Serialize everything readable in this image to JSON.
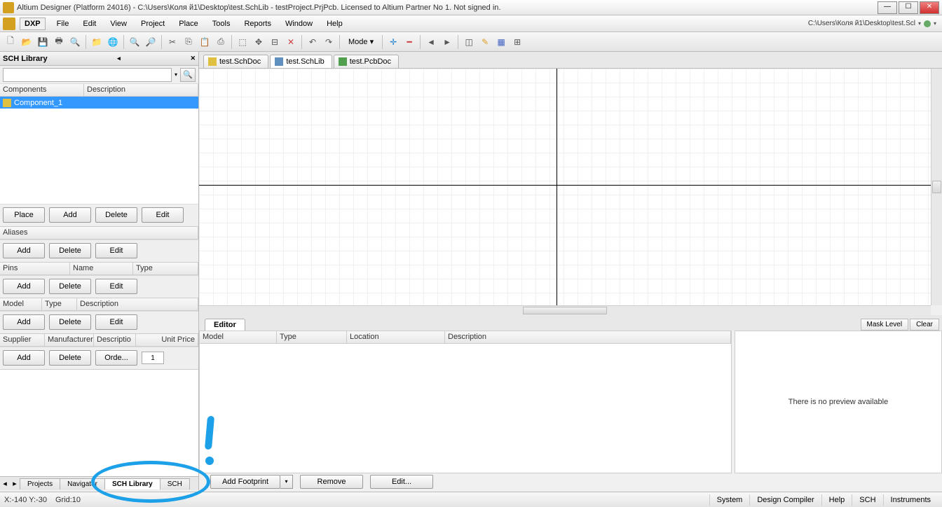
{
  "titlebar": {
    "text": "Altium Designer (Platform 24016) - C:\\Users\\Коля й1\\Desktop\\test.SchLib - testProject.PrjPcb. Licensed to Altium Partner No 1. Not signed in."
  },
  "menu": {
    "dxp": "DXP",
    "items": [
      "File",
      "Edit",
      "View",
      "Project",
      "Place",
      "Tools",
      "Reports",
      "Window",
      "Help"
    ],
    "rightpath": "C:\\Users\\Коля й1\\Desktop\\test.Scl"
  },
  "toolbar": {
    "mode": "Mode"
  },
  "doctabs": [
    {
      "label": "test.SchDoc",
      "color": "#e0c040"
    },
    {
      "label": "test.SchLib",
      "color": "#6090c0",
      "active": true
    },
    {
      "label": "test.PcbDoc",
      "color": "#50a050"
    }
  ],
  "panel": {
    "title": "SCH Library",
    "components": {
      "cols": [
        "Components",
        "Description"
      ],
      "rows": [
        {
          "name": "Component_1"
        }
      ]
    },
    "btns1": [
      "Place",
      "Add",
      "Delete",
      "Edit"
    ],
    "aliases": {
      "header": "Aliases",
      "btns": [
        "Add",
        "Delete",
        "Edit"
      ]
    },
    "pins": {
      "cols": [
        "Pins",
        "Name",
        "Type"
      ],
      "btns": [
        "Add",
        "Delete",
        "Edit"
      ]
    },
    "models": {
      "cols": [
        "Model",
        "Type",
        "Description"
      ],
      "btns": [
        "Add",
        "Delete",
        "Edit"
      ]
    },
    "supplier": {
      "cols": [
        "Supplier",
        "Manufacturer",
        "Descriptio",
        "Unit Price"
      ],
      "btns": [
        "Add",
        "Delete",
        "Orde..."
      ],
      "qty": "1"
    },
    "bottomtabs": [
      "Projects",
      "Navigator",
      "SCH Library",
      "SCH"
    ],
    "activetab": 2
  },
  "editor": {
    "tab": "Editor",
    "rbtns": [
      "Mask Level",
      "Clear"
    ],
    "cols": [
      "Model",
      "Type",
      "Location",
      "Description"
    ]
  },
  "preview": {
    "text": "There is no preview available"
  },
  "footprint": {
    "add": "Add Footprint",
    "remove": "Remove",
    "edit": "Edit..."
  },
  "status": {
    "xy": "X:-140 Y:-30",
    "grid": "Grid:10",
    "right": [
      "System",
      "Design Compiler",
      "Help",
      "SCH",
      "Instruments"
    ]
  }
}
